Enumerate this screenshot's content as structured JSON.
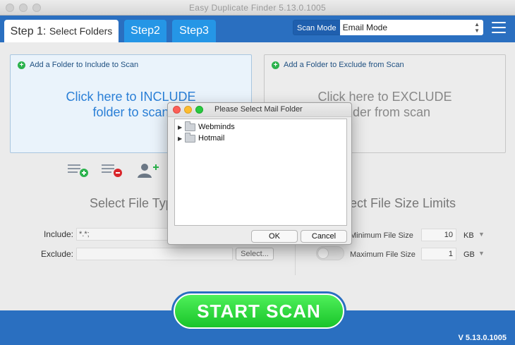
{
  "window": {
    "title": "Easy Duplicate Finder 5.13.0.1005"
  },
  "tabs": [
    {
      "number": "Step 1:",
      "name": "Select Folders"
    },
    {
      "label": "Step2"
    },
    {
      "label": "Step3"
    }
  ],
  "scan_mode": {
    "label": "Scan Mode",
    "value": "Email Mode"
  },
  "include_panel": {
    "header": "Add a Folder to Include to Scan",
    "line1": "Click here to INCLUDE",
    "line2": "folder to scan"
  },
  "exclude_panel": {
    "header": "Add a Folder to Exclude from Scan",
    "line1": "Click here to EXCLUDE",
    "line2": "folder from scan"
  },
  "file_types": {
    "title": "Select File Types",
    "include_label": "Include:",
    "include_value": "*.*;",
    "exclude_label": "Exclude:",
    "exclude_value": "",
    "select_button": "Select..."
  },
  "size_limits": {
    "title": "Select File Size Limits",
    "min_label": "Minimum File Size",
    "min_value": "10",
    "min_unit": "KB",
    "max_label": "Maximum File Size",
    "max_value": "1",
    "max_unit": "GB"
  },
  "start_button": "START  SCAN",
  "version": "V 5.13.0.1005",
  "dialog": {
    "title": "Please Select Mail Folder",
    "items": [
      "Webminds",
      "Hotmail"
    ],
    "ok": "OK",
    "cancel": "Cancel"
  },
  "colors": {
    "header_blue": "#2a6fc0",
    "tab_blue": "#2596e6",
    "start_green": "#19c42a",
    "include_text": "#2a7fd6"
  }
}
